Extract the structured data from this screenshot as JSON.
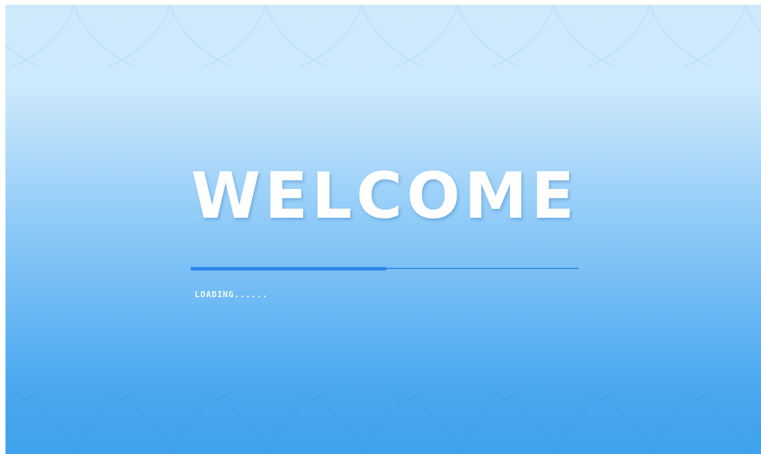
{
  "title": "WELCOME",
  "loading": {
    "label": "LOADING......",
    "level": 0.506
  }
}
